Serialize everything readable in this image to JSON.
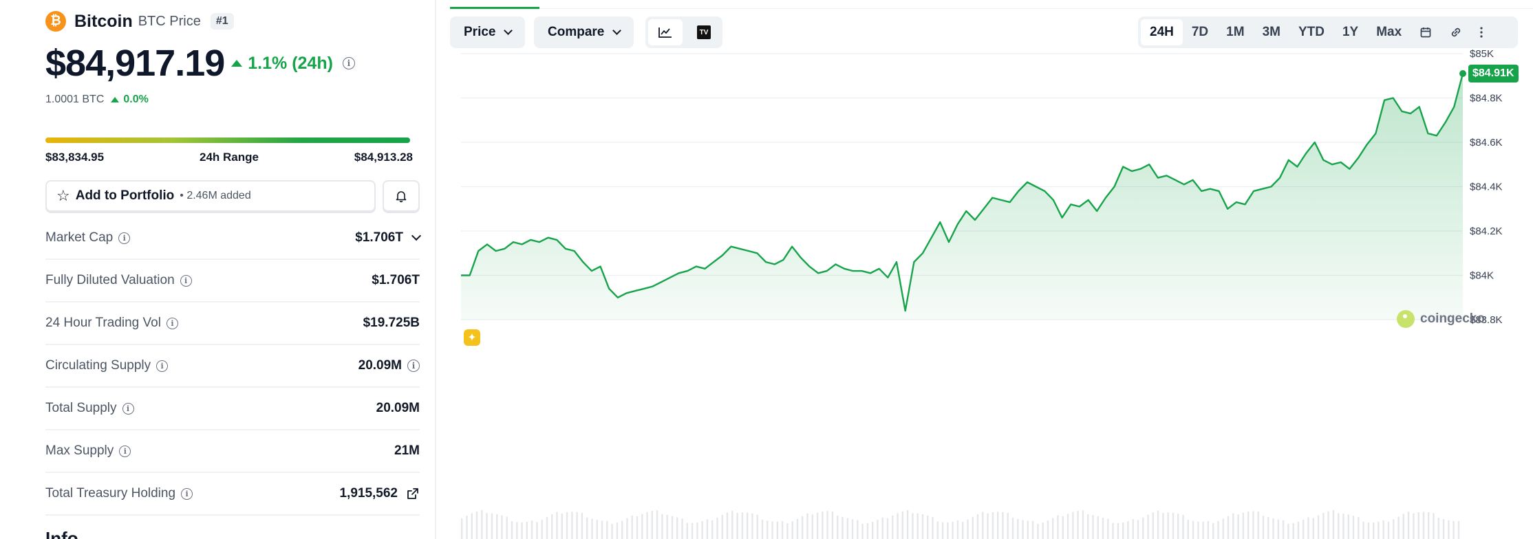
{
  "coin": {
    "logo_glyph": "₿",
    "name": "Bitcoin",
    "subtitle": "BTC Price",
    "rank": "#1",
    "price": "$84,917.19",
    "change_24h": "1.1% (24h)",
    "btc_value": "1.0001 BTC",
    "btc_change": "0.0%"
  },
  "range": {
    "low": "$83,834.95",
    "label": "24h Range",
    "high": "$84,913.28"
  },
  "portfolio": {
    "label": "Add to Portfolio",
    "count": "• 2.46M added"
  },
  "stats": [
    {
      "label": "Market Cap",
      "value": "$1.706T"
    },
    {
      "label": "Fully Diluted Valuation",
      "value": "$1.706T"
    },
    {
      "label": "24 Hour Trading Vol",
      "value": "$19.725B"
    },
    {
      "label": "Circulating Supply",
      "value": "20.09M"
    },
    {
      "label": "Total Supply",
      "value": "20.09M"
    },
    {
      "label": "Max Supply",
      "value": "21M"
    },
    {
      "label": "Total Treasury Holding",
      "value": "1,915,562"
    }
  ],
  "info_heading": "Info",
  "toolbar": {
    "price_label": "Price",
    "compare_label": "Compare",
    "tv_label": "TV",
    "ranges": [
      "24H",
      "7D",
      "1M",
      "3M",
      "YTD",
      "1Y",
      "Max"
    ],
    "active_range": "24H"
  },
  "chart": {
    "current_price_tag": "$84.91K",
    "watermark": "coingecko"
  },
  "colors": {
    "accent_green": "#16a34a",
    "bitcoin_orange": "#f7931a"
  },
  "chart_data": {
    "type": "area",
    "x_label": "",
    "y_label": "",
    "ylim": [
      83800,
      85000
    ],
    "y_ticks": [
      {
        "value": 85000,
        "label": "$85K"
      },
      {
        "value": 84800,
        "label": "$84.8K"
      },
      {
        "value": 84600,
        "label": "$84.6K"
      },
      {
        "value": 84400,
        "label": "$84.4K"
      },
      {
        "value": 84200,
        "label": "$84.2K"
      },
      {
        "value": 84000,
        "label": "$84K"
      },
      {
        "value": 83800,
        "label": "$83.8K"
      }
    ],
    "grid": true,
    "values": [
      84000,
      84000,
      84110,
      84140,
      84110,
      84120,
      84150,
      84140,
      84160,
      84150,
      84170,
      84160,
      84120,
      84110,
      84060,
      84020,
      84040,
      83940,
      83900,
      83920,
      83930,
      83940,
      83950,
      83970,
      83990,
      84010,
      84020,
      84040,
      84030,
      84060,
      84090,
      84130,
      84120,
      84110,
      84100,
      84060,
      84050,
      84070,
      84130,
      84080,
      84040,
      84010,
      84020,
      84050,
      84030,
      84020,
      84020,
      84010,
      84030,
      83990,
      84060,
      83840,
      84060,
      84100,
      84170,
      84240,
      84150,
      84230,
      84290,
      84250,
      84300,
      84350,
      84340,
      84330,
      84380,
      84420,
      84400,
      84380,
      84340,
      84260,
      84320,
      84310,
      84340,
      84290,
      84350,
      84400,
      84490,
      84470,
      84480,
      84500,
      84440,
      84450,
      84430,
      84410,
      84430,
      84380,
      84390,
      84380,
      84300,
      84330,
      84320,
      84380,
      84390,
      84400,
      84440,
      84520,
      84490,
      84550,
      84600,
      84520,
      84500,
      84510,
      84480,
      84530,
      84590,
      84640,
      84790,
      84800,
      84740,
      84730,
      84760,
      84640,
      84630,
      84690,
      84760,
      84910
    ]
  }
}
